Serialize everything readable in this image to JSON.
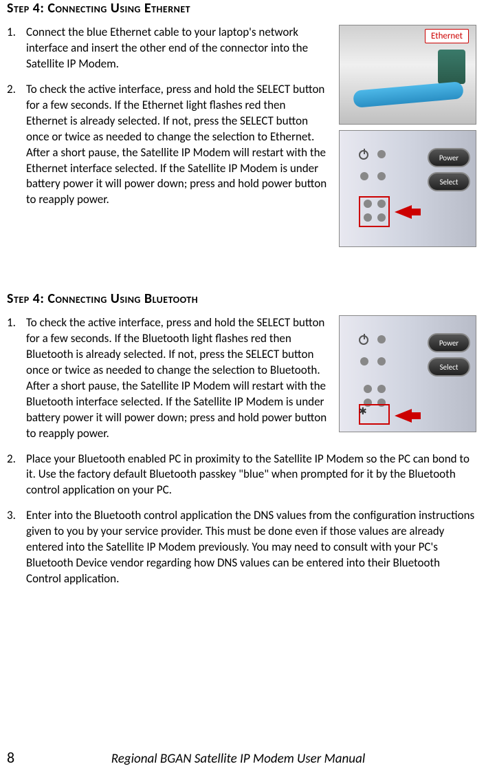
{
  "section1": {
    "heading": "Step 4: Connecting Using Ethernet",
    "items": [
      "Connect the blue Ethernet cable to your laptop's network interface and insert the other end of the connector into the Satellite IP Modem.",
      "To check the active interface, press and hold the SELECT button for a few seconds. If the Ethernet light flashes red then Ethernet is already selected. If not, press the SELECT button once or twice as needed to change the selection to Ethernet. After a short pause, the Satellite IP Modem will restart with the Ethernet interface selected. If the Satellite IP Modem is under battery power it will power down; press and hold power button to reapply power."
    ],
    "ethernet_label": "Ethernet",
    "power_label": "Power",
    "select_label": "Select"
  },
  "section2": {
    "heading": "Step 4: Connecting Using Bluetooth",
    "items": [
      "To check the active interface, press and hold the SELECT button for a few seconds. If the Bluetooth light flashes red then Bluetooth is already selected. If not, press the SELECT button once or twice as needed to change the selection to Bluetooth. After a short pause, the Satellite IP Modem will restart with the Bluetooth interface selected. If the Satellite IP Modem is under battery power it will power down; press and hold power button to reapply power.",
      "Place your Bluetooth enabled PC in proximity to the Satellite IP Modem so the PC can bond to it. Use the factory default Bluetooth passkey \"blue\" when prompted for it by the Bluetooth control application on your PC.",
      "Enter into the Bluetooth control application the DNS values from the configuration instructions given to you by your service provider. This must be done even if those values are already entered into the Satellite IP Modem previously. You may need to consult with your PC's Bluetooth Device vendor regarding how DNS values can be entered into their Bluetooth Control application."
    ],
    "power_label": "Power",
    "select_label": "Select"
  },
  "footer": {
    "page_number": "8",
    "manual_title": "Regional BGAN Satellite IP Modem User Manual"
  }
}
